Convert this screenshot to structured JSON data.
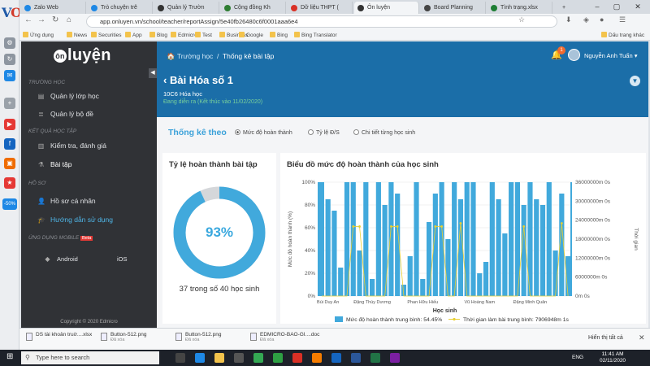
{
  "browser": {
    "tabs": [
      {
        "label": "Zalo Web",
        "color": "#1e88e5"
      },
      {
        "label": "Trò chuyện trê",
        "color": "#1e88e5"
      },
      {
        "label": "Quản lý Trườn",
        "color": "#333333"
      },
      {
        "label": "Cộng đồng Kh",
        "color": "#2e7d32"
      },
      {
        "label": "Dữ liệu THPT (",
        "color": "#d93025"
      },
      {
        "label": "Ôn luyện",
        "color": "#333333"
      },
      {
        "label": "Board Planning",
        "color": "#444444"
      },
      {
        "label": "Tình trạng.xlsx",
        "color": "#1e7e34"
      }
    ],
    "new_tab": "+",
    "url": "app.onluyen.vn/school/teacher/reportAssign/5e40fb26480c6f0001aaa6e4",
    "bookmarks": [
      "Ứng dụng",
      "News",
      "Securities",
      "App",
      "Blog",
      "Edmicro",
      "Test",
      "Business",
      "Google",
      "Bing",
      "Bing Translator"
    ],
    "other_bookmarks": "Dấu trang khác",
    "dock_badge": "-50%"
  },
  "sidebar": {
    "logo_o": "ôn",
    "logo_rest": "luyện",
    "sections": {
      "school": "TRƯỜNG HỌC",
      "study": "KẾT QUẢ HỌC TẬP",
      "profile": "HỒ SƠ",
      "mobile": "ỨNG DỤNG MOBILE",
      "beta": "Beta"
    },
    "items": {
      "classes": "Quản lý lớp học",
      "question_sets": "Quản lý bộ đề",
      "tests": "Kiểm tra, đánh giá",
      "homework": "Bài tập",
      "personal": "Hồ sơ cá nhân",
      "guide": "Hướng dẫn sử dụng",
      "android": "Android",
      "ios": "iOS"
    },
    "copyright": "Copyright © 2020 Edmicro"
  },
  "header": {
    "crumb_home": "Trường học",
    "crumb_current": "Thống kê bài tập",
    "title": "Bài Hóa số 1",
    "class": "10C6 Hóa học",
    "status": "Đang diễn ra (Kết thúc vào 11/02/2020)",
    "notif_count": "1",
    "user": "Nguyễn Anh Tuấn"
  },
  "stats": {
    "heading": "Thống kê theo",
    "options": [
      "Mức độ hoàn thành",
      "Tỷ lệ Đ/S",
      "Chi tiết từng học sinh"
    ],
    "completion_title": "Tỷ lệ hoàn thành bài tập",
    "completion_pct": "93%",
    "completion_count": "37 trong số 40 học sinh",
    "completion_value": 0.93,
    "chart_title": "Biểu đồ mức độ hoàn thành của học sinh"
  },
  "chart_data": {
    "type": "bar",
    "title": "Biểu đồ mức độ hoàn thành của học sinh",
    "xlabel": "Học sinh",
    "ylabel": "Mức độ hoàn thành (%)",
    "y2label": "Thời gian",
    "yticks": [
      "0%",
      "20%",
      "40%",
      "60%",
      "80%",
      "100%"
    ],
    "y2ticks": [
      "0m 0s",
      "6000000m 0s",
      "12000000m 0s",
      "18000000m 0s",
      "24000000m 0s",
      "30000000m 0s",
      "36000000m 0s"
    ],
    "xticks": [
      "Bùi Duy An",
      "Đặng Thùy Dương",
      "Phan Hữu Hiếu",
      "Vũ Hoàng Nam",
      "Đặng Minh Quân"
    ],
    "ylim": [
      0,
      100
    ],
    "bars": [
      100,
      85,
      75,
      25,
      100,
      100,
      40,
      100,
      15,
      100,
      80,
      100,
      90,
      10,
      35,
      100,
      15,
      65,
      90,
      100,
      50,
      100,
      85,
      100,
      100,
      20,
      30,
      100,
      85,
      55,
      100,
      100,
      80,
      100,
      85,
      80,
      100,
      40,
      90,
      35
    ],
    "time": [
      0,
      0,
      0,
      0,
      0,
      22,
      22,
      0,
      0,
      0,
      0,
      22,
      22,
      0,
      0,
      0,
      0,
      0,
      22,
      22,
      0,
      0,
      23,
      0,
      0,
      0,
      0,
      0,
      0,
      0,
      0,
      0,
      22,
      0,
      0,
      0,
      0,
      0,
      23,
      0
    ],
    "legend": [
      {
        "name": "Mức độ hoàn thành trung bình: 54.45%",
        "color": "#41a9dc"
      },
      {
        "name": "Thời gian làm bài trung bình: 7906948m 1s",
        "color": "#e8cf33"
      }
    ]
  },
  "downloads": [
    {
      "name": "DS tài khoản truờ....xlsx",
      "sub": ""
    },
    {
      "name": "Button-512.png",
      "sub": "Đã xóa"
    },
    {
      "name": "Button-512.png",
      "sub": "Đã xóa"
    },
    {
      "name": "EDMICRO-BAO-GI....doc",
      "sub": "Đã xóa"
    }
  ],
  "downloads_all": "Hiển thị tất cả",
  "taskbar": {
    "search": "Type here to search",
    "lang": "ENG",
    "time": "11:41 AM",
    "date": "02/11/2020"
  }
}
